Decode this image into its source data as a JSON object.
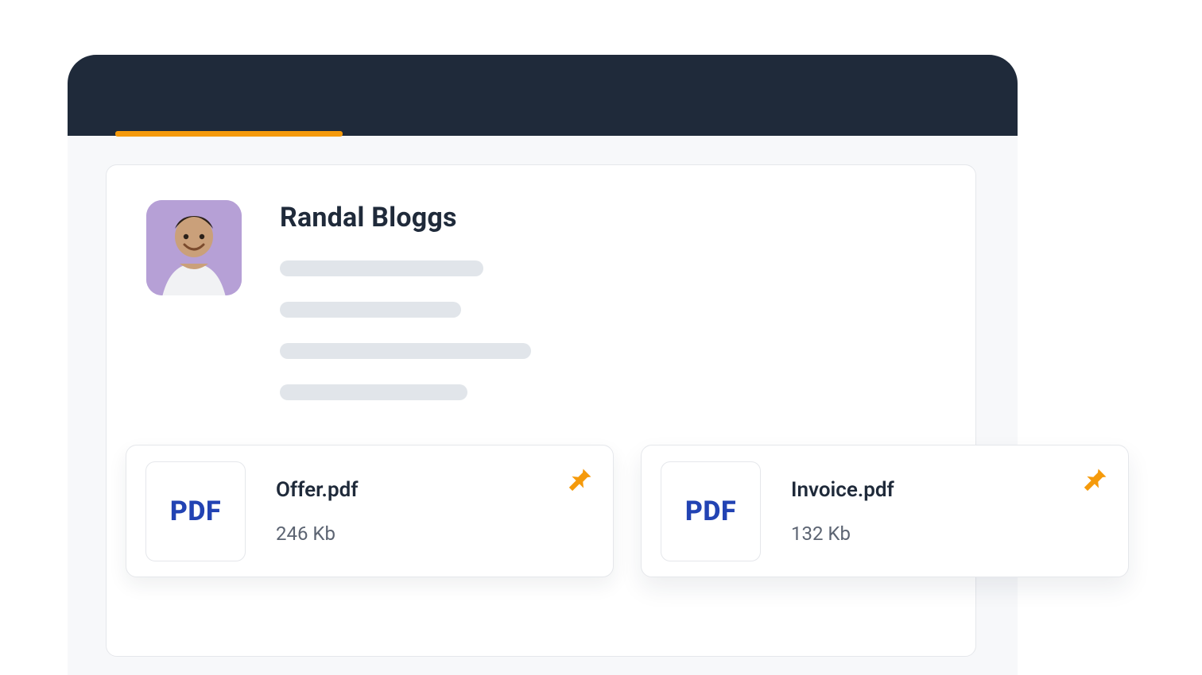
{
  "colors": {
    "header": "#1f2a3a",
    "accent": "#f59a0b",
    "pdf_text": "#2243b3",
    "muted": "#5c6472",
    "avatar_bg": "#b6a0d6"
  },
  "profile": {
    "name": "Randal Bloggs"
  },
  "files": [
    {
      "type_label": "PDF",
      "name": "Offer.pdf",
      "size": "246 Kb",
      "pinned": true
    },
    {
      "type_label": "PDF",
      "name": "Invoice.pdf",
      "size": "132 Kb",
      "pinned": true
    }
  ]
}
